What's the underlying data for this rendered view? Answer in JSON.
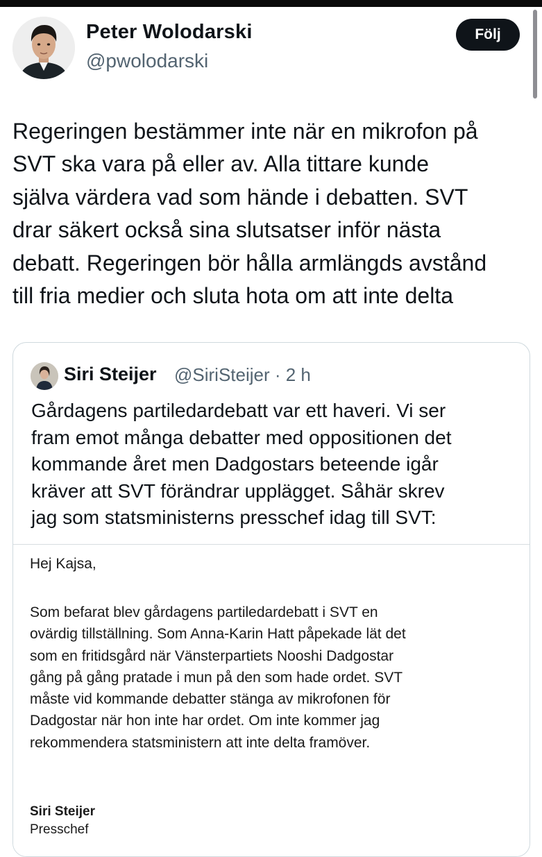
{
  "author": {
    "display_name": "Peter Wolodarski",
    "handle": "@pwolodarski"
  },
  "follow_button": {
    "label": "Följ"
  },
  "tweet": {
    "lines": [
      "Regeringen bestämmer inte när en mikrofon på",
      "SVT ska vara på eller av. Alla tittare kunde",
      "själva värdera vad som hände i debatten. SVT",
      "drar säkert också sina slutsatser inför nästa",
      "debatt. Regeringen bör hålla armlängds avstånd",
      "till fria medier och sluta hota om att inte delta"
    ]
  },
  "quoted_tweet": {
    "display_name": "Siri Steijer",
    "meta": "@SiriSteijer · 2 h",
    "lines": [
      "Gårdagens partiledardebatt var ett haveri. Vi ser",
      "fram emot många debatter med oppositionen det",
      "kommande året men Dadgostars beteende igår",
      "kräver att SVT förändrar upplägget. Såhär skrev",
      "jag som statsministerns presschef idag till SVT:"
    ],
    "email": {
      "greeting": "Hej Kajsa,",
      "lines": [
        "Som befarat blev gårdagens partiledardebatt i SVT en",
        "ovärdig tillställning. Som Anna-Karin Hatt påpekade lät det",
        "som en fritidsgård när Vänsterpartiets Nooshi Dadgostar",
        "gång på gång pratade i mun på den som hade ordet. SVT",
        "måste vid kommande debatter stänga av mikrofonen för",
        "Dadgostar när hon inte har ordet. Om inte kommer jag",
        "rekommendera statsministern att inte delta framöver."
      ],
      "signature_name": "Siri Steijer",
      "signature_title": "Presschef"
    }
  },
  "colors": {
    "text": "#0f1419",
    "secondary_text": "#536471",
    "button_bg": "#0f1419",
    "button_text": "#ffffff",
    "card_border": "#cfd9de"
  },
  "icons": {
    "author_avatar": "profile-photo",
    "quoted_avatar": "profile-photo"
  }
}
